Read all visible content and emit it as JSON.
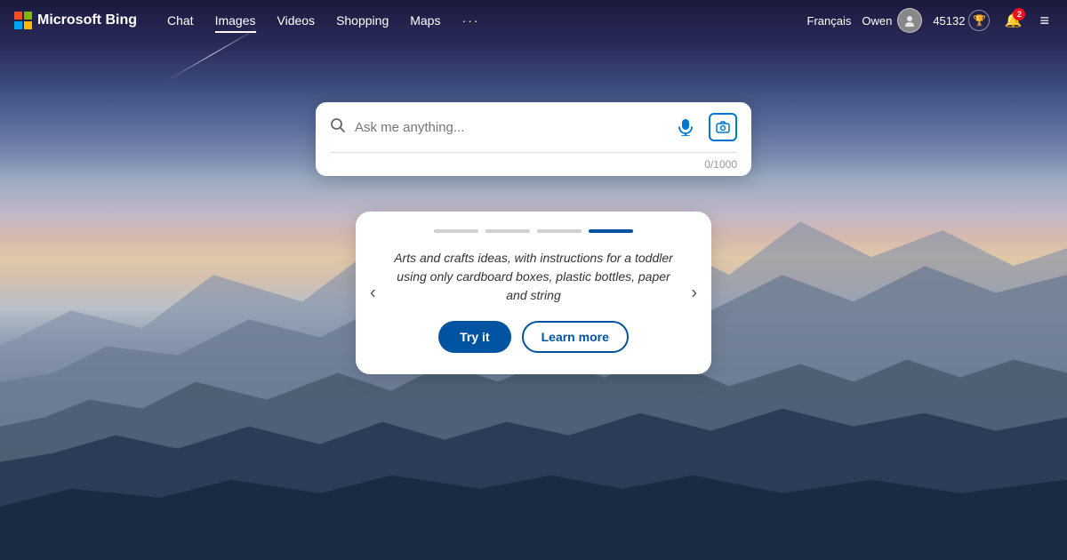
{
  "brand": {
    "name": "Microsoft Bing",
    "logo_text": "Microsoft Bing"
  },
  "nav": {
    "items": [
      {
        "label": "Chat",
        "active": false
      },
      {
        "label": "Images",
        "active": true
      },
      {
        "label": "Videos",
        "active": false
      },
      {
        "label": "Shopping",
        "active": false
      },
      {
        "label": "Maps",
        "active": false
      }
    ],
    "more_label": "···"
  },
  "user": {
    "language": "Français",
    "name": "Owen",
    "points": "45132",
    "notification_count": "2"
  },
  "search": {
    "placeholder": "Ask me anything...",
    "char_count": "0/1000"
  },
  "suggestion": {
    "text": "Arts and crafts ideas, with instructions for a toddler using only cardboard boxes, plastic bottles, paper and string",
    "try_it_label": "Try it",
    "learn_more_label": "Learn more",
    "pages": [
      {
        "active": false
      },
      {
        "active": false
      },
      {
        "active": false
      },
      {
        "active": true
      }
    ]
  },
  "icons": {
    "search": "🔍",
    "mic": "🎤",
    "camera": "📷",
    "trophy": "🏆",
    "bell": "🔔",
    "hamburger": "≡",
    "prev": "‹",
    "next": "›"
  },
  "colors": {
    "primary": "#0053a0",
    "accent": "#0078d4",
    "notification_red": "#e81123"
  }
}
